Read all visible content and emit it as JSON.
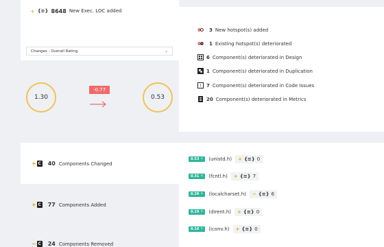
{
  "top": {
    "loc_value": "8648",
    "loc_label": "New Exec. LOC added",
    "dropdown_value": "Changes : Overall Rating",
    "rating_before": "1.30",
    "rating_after": "0.53",
    "rating_delta": "-0.77"
  },
  "summary": [
    {
      "icon": "hotspot-new-icon",
      "count": "3",
      "text": "New hotspot(s) added"
    },
    {
      "icon": "hotspot-deteriorated-icon",
      "count": "1",
      "text": "Existing hotspot(s) deteriorated"
    },
    {
      "icon": "design-icon",
      "count": "6",
      "text": "Component(s) deteriorated in Design"
    },
    {
      "icon": "duplication-icon",
      "count": "1",
      "text": "Component(s) deteriorated in Duplication"
    },
    {
      "icon": "code-issues-icon",
      "count": "7",
      "text": "Component(s) deteriorated in Code Issues"
    },
    {
      "icon": "metrics-icon",
      "count": "20",
      "text": "Component(s) deteriorated in Metrics"
    }
  ],
  "components": {
    "changed_count": "40",
    "changed_label": "Components Changed",
    "added_count": "77",
    "added_label": "Components Added",
    "removed_count": "24",
    "removed_label": "Components Removed"
  },
  "files": [
    {
      "rating": "0.53",
      "name": "(unistd.h)",
      "sign": "+",
      "count": "0"
    },
    {
      "rating": "0.31",
      "name": "(fcntl.h)",
      "sign": "+",
      "count": "7"
    },
    {
      "rating": "0.29",
      "name": "(localcharset.h)",
      "sign": "−",
      "count": "6"
    },
    {
      "rating": "0.19",
      "name": "(dirent.h)",
      "sign": "+",
      "count": "0"
    },
    {
      "rating": "0.16",
      "name": "(iconv.h)",
      "sign": "+",
      "count": "0"
    }
  ],
  "colors": {
    "accent_green": "#2fb59a",
    "accent_yellow": "#f2c15c",
    "delta_red": "#ef6b6b"
  }
}
